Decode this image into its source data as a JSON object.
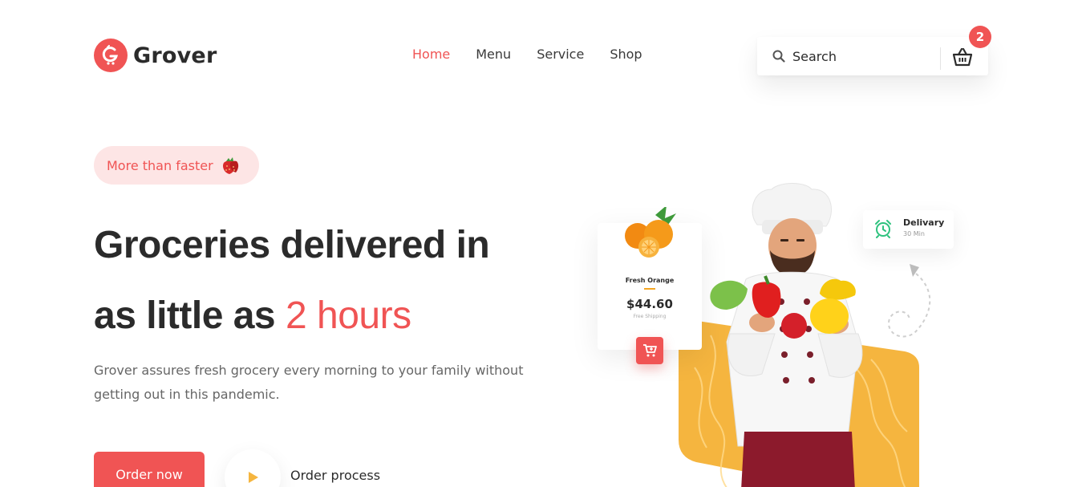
{
  "brand": {
    "name": "Grover"
  },
  "nav": {
    "items": [
      {
        "label": "Home",
        "active": true
      },
      {
        "label": "Menu",
        "active": false
      },
      {
        "label": "Service",
        "active": false
      },
      {
        "label": "Shop",
        "active": false
      }
    ]
  },
  "search": {
    "placeholder": "Search",
    "value": ""
  },
  "cart": {
    "count": "2"
  },
  "hero": {
    "tag": "More than faster",
    "headline_part1": "Groceries delivered in",
    "headline_part2": "as little as",
    "headline_accent": "2 hours",
    "description": "Grover assures fresh grocery every morning to your family without getting out in this pandemic.",
    "order_button": "Order now",
    "process_label": "Order process"
  },
  "product_card": {
    "name": "Fresh Orange",
    "price": "$44.60",
    "shipping": "Free Shipping"
  },
  "delivery_card": {
    "title": "Delivary",
    "time": "30 Min"
  },
  "colors": {
    "accent": "#f05454",
    "accent_light": "#fde5e5",
    "yellow": "#f5b53f",
    "text": "#2b2b2b",
    "muted": "#666666",
    "clock": "#2ec27e"
  },
  "icons": [
    "logo-icon",
    "search-icon",
    "basket-icon",
    "strawberry-icon",
    "play-icon",
    "cart-icon",
    "alarm-clock-icon"
  ]
}
